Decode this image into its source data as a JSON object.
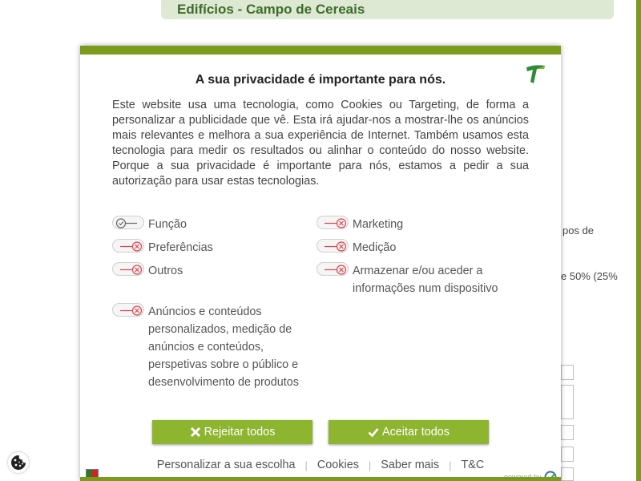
{
  "page": {
    "header_title": "Edifícios - Campo de Cereais",
    "bg_snippets": [
      "pos de",
      "e 50% (25%"
    ]
  },
  "modal": {
    "title": "A sua privacidade é importante para nós.",
    "description": "Este website usa uma tecnologia, como Cookies ou Targeting, de forma a personalizar a publicidade que vê. Esta irá ajudar-nos a mostrar-lhe os anúncios mais relevantes e melhora a sua experiência de Internet. Também usamos esta tecnologia para medir os resultados ou alinhar o conteúdo do nosso website. Porque a sua privacidade é importante para nós, estamos a pedir a sua autorização para usar estas tecnologias.",
    "options": [
      {
        "label": "Função",
        "state": "required"
      },
      {
        "label": "Marketing",
        "state": "off"
      },
      {
        "label": "Preferências",
        "state": "off"
      },
      {
        "label": "Medição",
        "state": "off"
      },
      {
        "label": "Outros",
        "state": "off"
      },
      {
        "label": "Armazenar e/ou aceder a informações num dispositivo",
        "state": "off"
      },
      {
        "label": "Anúncios e conteúdos personalizados, medição de anúncios e conteúdos, perspetivas sobre o público e desenvolvimento de produtos",
        "state": "off"
      }
    ],
    "reject_label": "Rejeitar todos",
    "accept_label": "Aceitar todos",
    "links": [
      "Personalizar a sua escolha",
      "Cookies",
      "Saber mais",
      "T&C"
    ],
    "powered_by": "powered by"
  },
  "colors": {
    "brand_green": "#7a9b1c",
    "button_green": "#8db52f",
    "off_red": "#e0434d"
  },
  "icons": [
    "logo-icon",
    "toggle-check-icon",
    "toggle-x-icon",
    "close-x-icon",
    "checkmark-icon",
    "portugal-flag-icon",
    "consent-shield-icon",
    "cookie-icon"
  ]
}
